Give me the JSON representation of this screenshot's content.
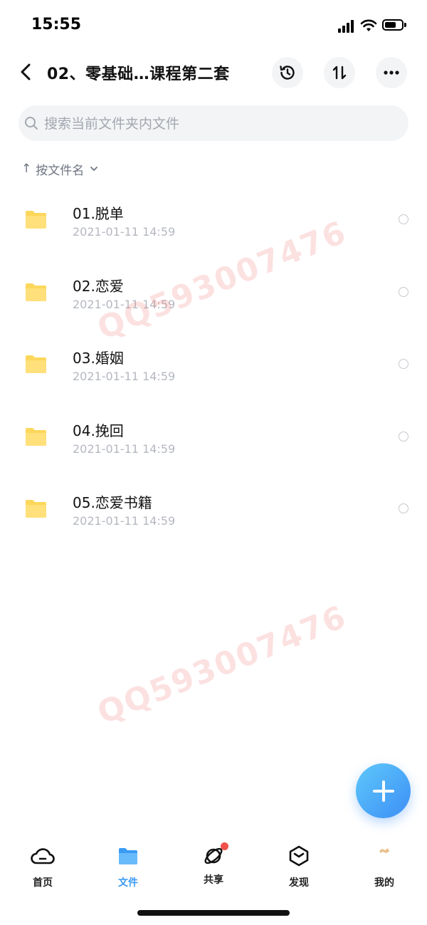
{
  "status_bar": {
    "time": "15:55"
  },
  "header": {
    "title": "02、零基础…课程第二套",
    "back_icon": "chevron-left-icon",
    "history_icon": "history-icon",
    "sort_icon": "sort-icon",
    "more_icon": "more-icon"
  },
  "search": {
    "placeholder": "搜索当前文件夹内文件",
    "value": ""
  },
  "sort": {
    "arrow": "↑",
    "label": "按文件名"
  },
  "files": [
    {
      "name": "01.脱单",
      "date": "2021-01-11 14:59"
    },
    {
      "name": "02.恋爱",
      "date": "2021-01-11 14:59"
    },
    {
      "name": "03.婚姻",
      "date": "2021-01-11 14:59"
    },
    {
      "name": "04.挽回",
      "date": "2021-01-11 14:59"
    },
    {
      "name": "05.恋爱书籍",
      "date": "2021-01-11 14:59"
    }
  ],
  "watermark": "QQ593007476",
  "tabs": [
    {
      "label": "首页",
      "icon": "cloud-icon"
    },
    {
      "label": "文件",
      "icon": "folder-icon",
      "active": true
    },
    {
      "label": "共享",
      "icon": "share-orbit-icon",
      "badge": true
    },
    {
      "label": "发现",
      "icon": "discover-box-icon"
    },
    {
      "label": "我的",
      "icon": "avatar-icon"
    }
  ],
  "colors": {
    "accent": "#3a9bf5",
    "folder": "#fcd75b",
    "badge": "#f2504b",
    "watermark": "#f07878"
  }
}
